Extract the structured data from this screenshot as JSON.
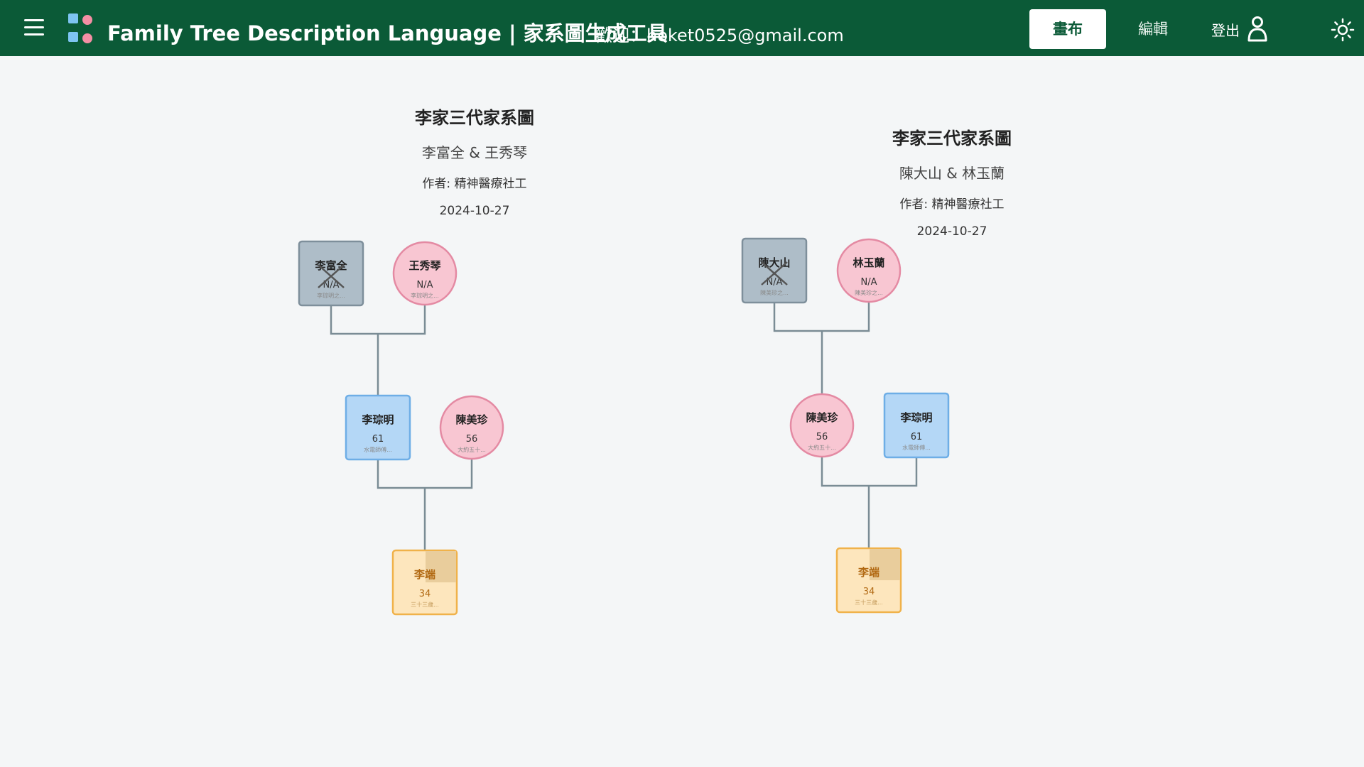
{
  "header": {
    "title": "Family Tree Description Language | 家系圖生成工具",
    "welcome": "歡迎：hoket0525@gmail.com",
    "tabs": [
      {
        "label": "畫布",
        "active": true
      },
      {
        "label": "編輯",
        "active": false
      }
    ],
    "logout_label": "登出",
    "colors": {
      "topbar": "#0b5a37",
      "background": "#f4f6f7"
    },
    "icons": {
      "menu": "hamburger-icon",
      "logo": "app-logo",
      "user": "user-icon",
      "theme": "sun-icon"
    }
  },
  "genograms": [
    {
      "title": "李家三代家系圖",
      "couple": "李富全 & 王秀琴",
      "author": "作者: 精神醫療社工",
      "date": "2024-10-27",
      "nodes": {
        "grandfather": {
          "name": "李富全",
          "age": "N/A",
          "note": "李琮明之...",
          "sex": "male",
          "deceased": true
        },
        "grandmother": {
          "name": "王秀琴",
          "age": "N/A",
          "note": "李琮明之...",
          "sex": "female"
        },
        "father": {
          "name": "李琮明",
          "age": "61",
          "note": "水電師傅...",
          "sex": "male"
        },
        "mother": {
          "name": "陳美珍",
          "age": "56",
          "note": "大約五十...",
          "sex": "female"
        },
        "child": {
          "name": "李端",
          "age": "34",
          "note": "三十三歲...",
          "sex": "other"
        }
      }
    },
    {
      "title": "李家三代家系圖",
      "couple": "陳大山 & 林玉蘭",
      "author": "作者: 精神醫療社工",
      "date": "2024-10-27",
      "nodes": {
        "grandfather": {
          "name": "陳大山",
          "age": "N/A",
          "note": "陳美珍之...",
          "sex": "male",
          "deceased": true
        },
        "grandmother": {
          "name": "林玉蘭",
          "age": "N/A",
          "note": "陳美珍之...",
          "sex": "female"
        },
        "mother": {
          "name": "陳美珍",
          "age": "56",
          "note": "大約五十...",
          "sex": "female"
        },
        "father": {
          "name": "李琮明",
          "age": "61",
          "note": "水電師傅...",
          "sex": "male"
        },
        "child": {
          "name": "李端",
          "age": "34",
          "note": "三十三歲...",
          "sex": "other"
        }
      }
    }
  ]
}
